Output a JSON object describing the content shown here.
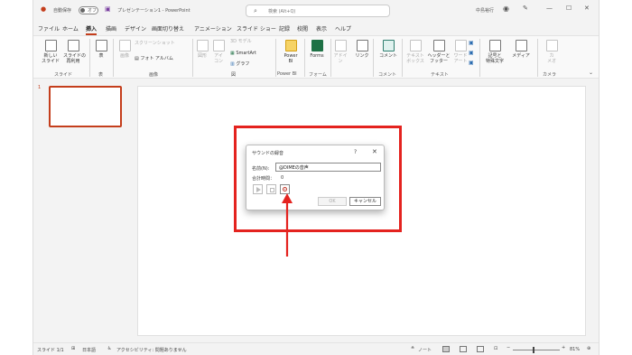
{
  "titlebar": {
    "autosave_label": "自動保存",
    "autosave_state": "オフ",
    "doc_title": "プレゼンテーション1 - PowerPoint",
    "search_placeholder": "検索 (Alt+Q)",
    "user_name": "中島裕行"
  },
  "tabs": [
    "ファイル",
    "ホーム",
    "挿入",
    "描画",
    "デザイン",
    "画面切り替え",
    "アニメーション",
    "スライド ショー",
    "記録",
    "校閲",
    "表示",
    "ヘルプ"
  ],
  "active_tab": "挿入",
  "toolbar_right": {
    "record_label": "記録",
    "share_label": "共有"
  },
  "ribbon": {
    "new_slide": "新しい\nスライド",
    "reuse_slide": "スライドの\n再利用",
    "table": "表",
    "images": "画像",
    "screenshot": "スクリーンショット",
    "photo_album": "フォト アルバム",
    "shapes": "図形",
    "icons": "アイ\nコン",
    "model_3d": "3D モデル",
    "smartart": "SmartArt",
    "chart": "グラフ",
    "powerbi": "Power\nBI",
    "forms": "Forms",
    "addins": "アドイ\nン",
    "link": "リンク",
    "comment": "コメント",
    "textbox": "テキスト\nボックス",
    "header_footer": "ヘッダーと\nフッター",
    "wordart": "ワード\nアート",
    "symbols": "記号と\n特殊文字",
    "media": "メディア",
    "cameo": "カ\nメオ",
    "groups": [
      "スライド",
      "表",
      "画像",
      "図",
      "Power BI",
      "フォーム",
      "コメント",
      "テキスト",
      "カメラ"
    ]
  },
  "thumbnail_number": "1",
  "dialog": {
    "title": "サウンドの録音",
    "help": "?",
    "close": "✕",
    "name_label": "名前(N):",
    "name_value": "@DIMEの音声",
    "time_label": "合計時間：",
    "time_value": "0",
    "ok_label": "OK",
    "cancel_label": "キャンセル"
  },
  "statusbar": {
    "slide_info": "スライド 1/1",
    "language": "日本語",
    "accessibility": "アクセシビリティ: 問題ありません",
    "notes": "ノート",
    "zoom": "81%"
  },
  "colors": {
    "accent": "#c43e1c",
    "annotation_red": "#e4231f",
    "window_bg": "#f3f3f3"
  }
}
